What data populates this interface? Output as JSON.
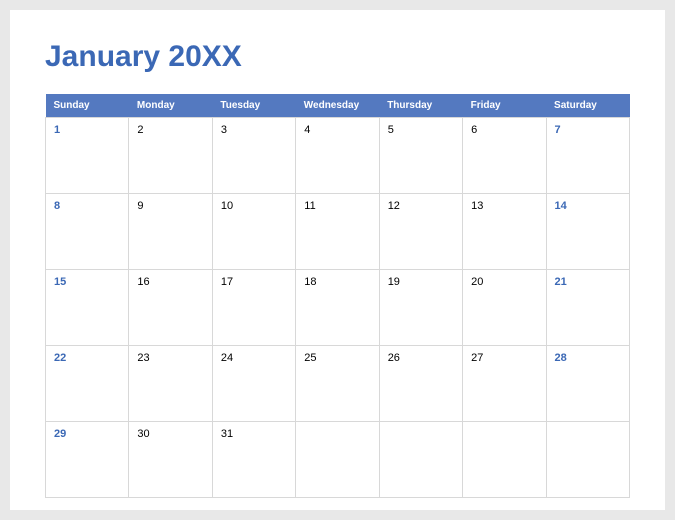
{
  "title": "January 20XX",
  "colors": {
    "accent": "#3b68b5",
    "header_bg": "#5479c0"
  },
  "headers": [
    "Sunday",
    "Monday",
    "Tuesday",
    "Wednesday",
    "Thursday",
    "Friday",
    "Saturday"
  ],
  "weeks": [
    [
      {
        "day": "1",
        "weekend": true
      },
      {
        "day": "2",
        "weekend": false
      },
      {
        "day": "3",
        "weekend": false
      },
      {
        "day": "4",
        "weekend": false
      },
      {
        "day": "5",
        "weekend": false
      },
      {
        "day": "6",
        "weekend": false
      },
      {
        "day": "7",
        "weekend": true
      }
    ],
    [
      {
        "day": "8",
        "weekend": true
      },
      {
        "day": "9",
        "weekend": false
      },
      {
        "day": "10",
        "weekend": false
      },
      {
        "day": "11",
        "weekend": false
      },
      {
        "day": "12",
        "weekend": false
      },
      {
        "day": "13",
        "weekend": false
      },
      {
        "day": "14",
        "weekend": true
      }
    ],
    [
      {
        "day": "15",
        "weekend": true
      },
      {
        "day": "16",
        "weekend": false
      },
      {
        "day": "17",
        "weekend": false
      },
      {
        "day": "18",
        "weekend": false
      },
      {
        "day": "19",
        "weekend": false
      },
      {
        "day": "20",
        "weekend": false
      },
      {
        "day": "21",
        "weekend": true
      }
    ],
    [
      {
        "day": "22",
        "weekend": true
      },
      {
        "day": "23",
        "weekend": false
      },
      {
        "day": "24",
        "weekend": false
      },
      {
        "day": "25",
        "weekend": false
      },
      {
        "day": "26",
        "weekend": false
      },
      {
        "day": "27",
        "weekend": false
      },
      {
        "day": "28",
        "weekend": true
      }
    ],
    [
      {
        "day": "29",
        "weekend": true
      },
      {
        "day": "30",
        "weekend": false
      },
      {
        "day": "31",
        "weekend": false
      },
      {
        "day": "",
        "weekend": false
      },
      {
        "day": "",
        "weekend": false
      },
      {
        "day": "",
        "weekend": false
      },
      {
        "day": "",
        "weekend": true
      }
    ]
  ]
}
